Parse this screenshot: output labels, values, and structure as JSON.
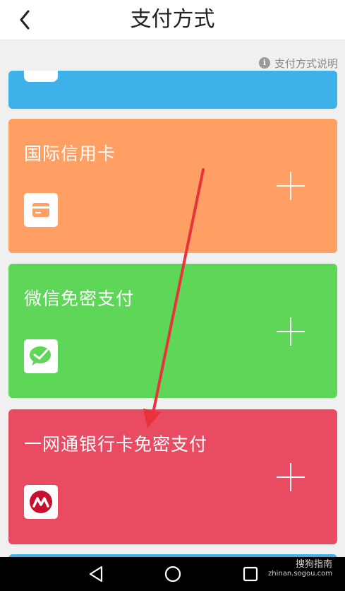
{
  "header": {
    "title": "支付方式"
  },
  "help": {
    "label": "支付方式说明",
    "icon": "info-icon"
  },
  "cards": [
    {
      "label": "",
      "color": "#3eb0ea",
      "icon": "partial-card-icon"
    },
    {
      "label": "国际信用卡",
      "color": "#ff9f63",
      "icon": "credit-card-icon"
    },
    {
      "label": "微信免密支付",
      "color": "#5ed657",
      "icon": "wechat-icon"
    },
    {
      "label": "一网通银行卡免密支付",
      "color": "#e84b62",
      "icon": "cmb-bank-icon"
    },
    {
      "label": "",
      "color": "#3eb0ea",
      "icon": ""
    }
  ],
  "annotation": {
    "color": "#e8333b"
  },
  "navbar": {
    "buttons": [
      "back-nav",
      "home-nav",
      "recents-nav"
    ]
  },
  "watermark": {
    "brand": "搜狗指南",
    "url": "zhinan.sogou.com"
  }
}
